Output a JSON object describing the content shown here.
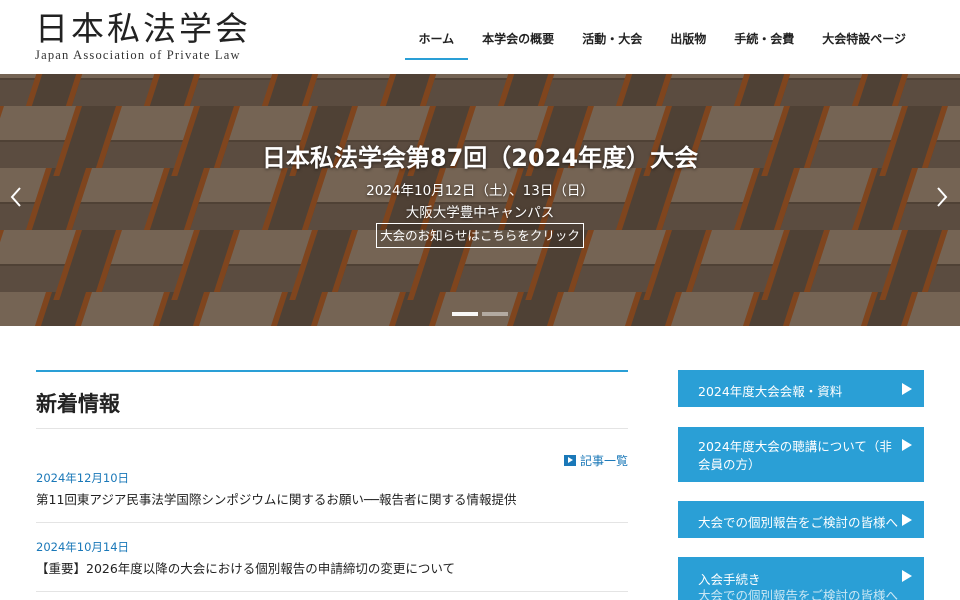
{
  "logo": {
    "jp": "日本私法学会",
    "en": "Japan Association of Private Law"
  },
  "nav": {
    "items": [
      {
        "label": "ホーム",
        "active": true
      },
      {
        "label": "本学会の概要"
      },
      {
        "label": "活動・大会"
      },
      {
        "label": "出版物"
      },
      {
        "label": "手続・会費"
      },
      {
        "label": "大会特設ページ"
      }
    ]
  },
  "hero": {
    "title": "日本私法学会第87回（2024年度）大会",
    "date": "2024年10月12日（土）、13日（日）",
    "place": "大阪大学豊中キャンパス",
    "button": "大会のお知らせはこちらをクリック",
    "prev_icon": "chevron-left-icon",
    "next_icon": "chevron-right-icon",
    "slides_count_visible": 2,
    "active_slide": 1
  },
  "news": {
    "title": "新着情報",
    "more_label": "記事一覧",
    "items": [
      {
        "date": "2024年12月10日",
        "text": "第11回東アジア民事法学国際シンポジウムに関するお願い──報告者に関する情報提供"
      },
      {
        "date": "2024年10月14日",
        "text": "【重要】2026年度以降の大会における個別報告の申請締切の変更について"
      }
    ]
  },
  "sidebar": {
    "items": [
      {
        "label": "2024年度大会会報・資料"
      },
      {
        "label": "2024年度大会の聴講について（非会員の方）"
      },
      {
        "label": "大会での個別報告をご検討の皆様へ"
      },
      {
        "label": "入会手続き",
        "ghost": "大会での個別報告をご検討の皆様へ"
      }
    ]
  },
  "colors": {
    "accent": "#2a9fd6",
    "link": "#1a78b8"
  }
}
